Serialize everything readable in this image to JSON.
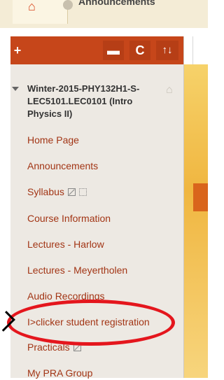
{
  "breadcrumb": {
    "current": "Announcements"
  },
  "icons": {
    "home": "home-icon",
    "chevron": "chevron-icon",
    "add": "plus-icon",
    "folder": "folder-icon",
    "refresh": "refresh-icon",
    "sort": "sort-icon"
  },
  "toolbar": {
    "add_label": "+",
    "refresh_label": "C",
    "sort_label": "↑↓"
  },
  "course": {
    "title": "Winter-2015-PHY132H1-S-LEC5101.LEC0101 (Intro Physics II)"
  },
  "menu": [
    {
      "label": "Home Page"
    },
    {
      "label": "Announcements"
    },
    {
      "label": "Syllabus"
    },
    {
      "label": "Course Information"
    },
    {
      "label": "Lectures - Harlow"
    },
    {
      "label": "Lectures - Meyertholen"
    },
    {
      "label": "Audio Recordings"
    },
    {
      "label": "I>clicker student registration"
    },
    {
      "label": "Practicals"
    },
    {
      "label": "My PRA Group"
    }
  ],
  "colors": {
    "accent": "#c6461a",
    "link": "#a23515",
    "annotation": "#e4161d"
  }
}
